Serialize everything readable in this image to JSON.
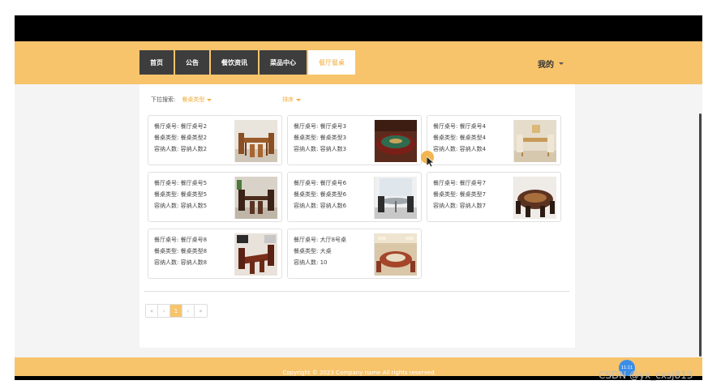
{
  "nav": {
    "items": [
      {
        "label": "首页"
      },
      {
        "label": "公告"
      },
      {
        "label": "餐饮资讯"
      },
      {
        "label": "菜品中心"
      },
      {
        "label": "餐厅餐桌"
      }
    ],
    "active_index": 4,
    "user_label": "我的"
  },
  "filters": {
    "dropdown_label": "下拉搜索:",
    "type_dropdown": "餐桌类型",
    "sort_label": "排序"
  },
  "cards": [
    {
      "table_no": "餐厅桌号: 餐厅桌号2",
      "type": "餐桌类型: 餐桌类型2",
      "capacity": "容纳人数: 容纳人数2",
      "image": "wooden-dining-table-photo"
    },
    {
      "table_no": "餐厅桌号: 餐厅桌号3",
      "type": "餐桌类型: 餐桌类型3",
      "capacity": "容纳人数: 容纳人数3",
      "image": "round-banquet-table-photo"
    },
    {
      "table_no": "餐厅桌号: 餐厅桌号4",
      "type": "餐桌类型: 餐桌类型4",
      "capacity": "容纳人数: 容纳人数4",
      "image": "light-wood-table-photo"
    },
    {
      "table_no": "餐厅桌号: 餐厅桌号5",
      "type": "餐桌类型: 餐桌类型5",
      "capacity": "容纳人数: 容纳人数5",
      "image": "dark-dining-set-photo"
    },
    {
      "table_no": "餐厅桌号: 餐厅桌号6",
      "type": "餐桌类型: 餐桌类型6",
      "capacity": "容纳人数: 容纳人数6",
      "image": "glass-round-table-photo"
    },
    {
      "table_no": "餐厅桌号: 餐厅桌号7",
      "type": "餐桌类型: 餐桌类型7",
      "capacity": "容纳人数: 容纳人数7",
      "image": "large-round-table-photo"
    },
    {
      "table_no": "餐厅桌号: 餐厅桌号8",
      "type": "餐桌类型: 餐桌类型8",
      "capacity": "容纳人数: 容纳人数8",
      "image": "red-wood-dining-set-photo"
    },
    {
      "table_no": "餐厅桌号: 大厅8号桌",
      "type": "餐桌类型: 大桌",
      "capacity": "容纳人数: 10",
      "image": "banquet-hall-photo"
    }
  ],
  "pagination": {
    "first": "«",
    "prev": "‹",
    "current": "1",
    "next": "›",
    "last": "»"
  },
  "footer": {
    "copyright": "Copyright © 2023 Company name All rights reserved"
  },
  "overlay": {
    "badge_text": "11:11",
    "watermark": "CSDN @yx_cxsj813"
  },
  "colors": {
    "accent": "#f7c46c",
    "accent_text": "#f1ad3d",
    "nav_dark": "#3d3d3d"
  }
}
